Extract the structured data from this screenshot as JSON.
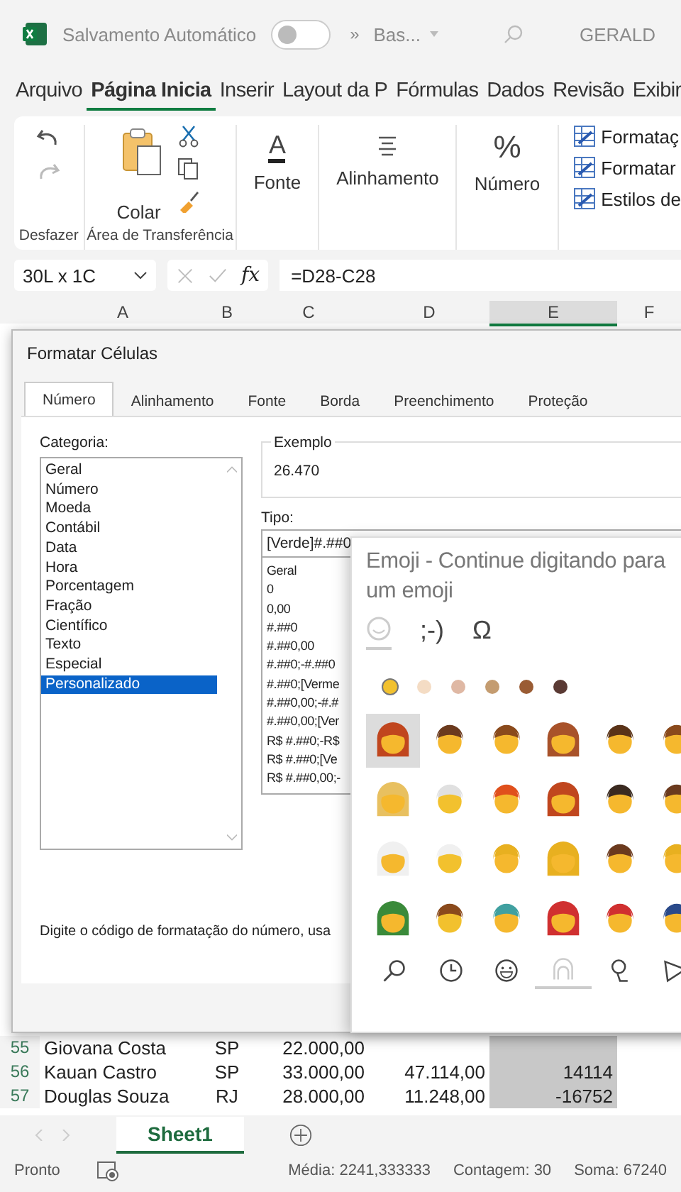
{
  "titlebar": {
    "autosave_label": "Salvamento Automático",
    "autosave_on": false,
    "overflow": "»",
    "file_name": "Bas...",
    "user": "GERALD"
  },
  "ribbon_tabs": [
    {
      "label": "Arquivo",
      "selected": false
    },
    {
      "label": "Página Inicia",
      "selected": true
    },
    {
      "label": "Inserir",
      "selected": false
    },
    {
      "label": "Layout da P",
      "selected": false
    },
    {
      "label": "Fórmulas",
      "selected": false
    },
    {
      "label": "Dados",
      "selected": false
    },
    {
      "label": "Revisão",
      "selected": false
    },
    {
      "label": "Exibir",
      "selected": false
    }
  ],
  "ribbon": {
    "undo_group": "Desfazer",
    "paste": "Colar",
    "clipboard_group": "Área de Transferência",
    "font_symbol": "A",
    "font": "Fonte",
    "alignment": "Alinhamento",
    "number_symbol": "%",
    "number": "Número",
    "styles": [
      "Formataç",
      "Formatar",
      "Estilos de"
    ]
  },
  "formula_bar": {
    "name_box": "30L x 1C",
    "fx": "fx",
    "formula": "=D28-C28"
  },
  "columns": [
    {
      "label": "A",
      "selected": false
    },
    {
      "label": "B",
      "selected": false
    },
    {
      "label": "C",
      "selected": false
    },
    {
      "label": "D",
      "selected": false
    },
    {
      "label": "E",
      "selected": true
    },
    {
      "label": "F",
      "selected": false
    }
  ],
  "rows": [
    {
      "number": "55",
      "cells": [
        "Giovana Costa",
        "SP",
        "22.000,00"
      ]
    },
    {
      "number": "56",
      "cells": [
        "Kauan Castro",
        "SP",
        "33.000,00",
        "47.114,00",
        "14114"
      ]
    },
    {
      "number": "57",
      "cells": [
        "Douglas Souza",
        "RJ",
        "28.000,00",
        "11.248,00",
        "-16752"
      ]
    }
  ],
  "sheet_tabs": [
    {
      "label": "Sheet1",
      "selected": true
    }
  ],
  "status": {
    "state": "Pronto",
    "average": "Média: 2241,333333",
    "count": "Contagem: 30",
    "sum": "Soma: 67240"
  },
  "dialog": {
    "title": "Formatar Células",
    "tabs": [
      {
        "label": "Número",
        "selected": true
      },
      {
        "label": "Alinhamento",
        "selected": false
      },
      {
        "label": "Fonte",
        "selected": false
      },
      {
        "label": "Borda",
        "selected": false
      },
      {
        "label": "Preenchimento",
        "selected": false
      },
      {
        "label": "Proteção",
        "selected": false
      }
    ],
    "category_label": "Categoria:",
    "categories": [
      {
        "label": "Geral",
        "selected": false
      },
      {
        "label": "Número",
        "selected": false
      },
      {
        "label": "Moeda",
        "selected": false
      },
      {
        "label": "Contábil",
        "selected": false
      },
      {
        "label": "Data",
        "selected": false
      },
      {
        "label": "Hora",
        "selected": false
      },
      {
        "label": "Porcentagem",
        "selected": false
      },
      {
        "label": "Fração",
        "selected": false
      },
      {
        "label": "Científico",
        "selected": false
      },
      {
        "label": "Texto",
        "selected": false
      },
      {
        "label": "Especial",
        "selected": false
      },
      {
        "label": "Personalizado",
        "selected": true
      }
    ],
    "sample_label": "Exemplo",
    "sample_value": "26.470",
    "type_label": "Tipo:",
    "type_value": "[Verde]#.##0",
    "formats": [
      "Geral",
      "0",
      "0,00",
      "#.##0",
      "#.##0,00",
      "#.##0;-#.##0",
      "#.##0;[Verme",
      "#.##0,00;-#.#",
      "#.##0,00;[Ver",
      "R$ #.##0;-R$",
      "R$ #.##0;[Ve",
      "R$ #.##0,00;-"
    ],
    "hint": "Digite o código de formatação do número, usa"
  },
  "emoji_panel": {
    "title_lines": [
      "Emoji - Continue digitando para",
      "um emoji"
    ],
    "modes": [
      {
        "kind": "face",
        "selected": true
      },
      {
        "kind": "text",
        "label": ";-)",
        "selected": false
      },
      {
        "kind": "text",
        "label": "Ω",
        "selected": false
      }
    ],
    "skin_tones": [
      {
        "color": "#f2c12e",
        "selected": true
      },
      {
        "color": "#f4dcc4",
        "selected": false
      },
      {
        "color": "#dfb8a4",
        "selected": false
      },
      {
        "color": "#c49c70",
        "selected": false
      },
      {
        "color": "#9a5c34",
        "selected": false
      },
      {
        "color": "#5a3a34",
        "selected": false
      }
    ],
    "emojis": [
      {
        "selected": true
      },
      {
        "selected": false
      },
      {
        "selected": false
      },
      {
        "selected": false
      },
      {
        "selected": false
      },
      {
        "selected": false
      },
      {
        "selected": false
      },
      {
        "selected": false
      },
      {
        "selected": false
      },
      {
        "selected": false
      },
      {
        "selected": false
      },
      {
        "selected": false
      },
      {
        "selected": false
      },
      {
        "selected": false
      },
      {
        "selected": false
      },
      {
        "selected": false
      },
      {
        "selected": false
      },
      {
        "selected": false
      },
      {
        "selected": false
      },
      {
        "selected": false
      },
      {
        "selected": false
      },
      {
        "selected": false
      },
      {
        "selected": false
      },
      {
        "selected": false
      }
    ],
    "categories": [
      {
        "kind": "search",
        "selected": false
      },
      {
        "kind": "recent",
        "selected": false
      },
      {
        "kind": "smiley",
        "selected": false
      },
      {
        "kind": "people",
        "selected": true
      },
      {
        "kind": "pin",
        "selected": false
      },
      {
        "kind": "food",
        "selected": false
      }
    ]
  }
}
